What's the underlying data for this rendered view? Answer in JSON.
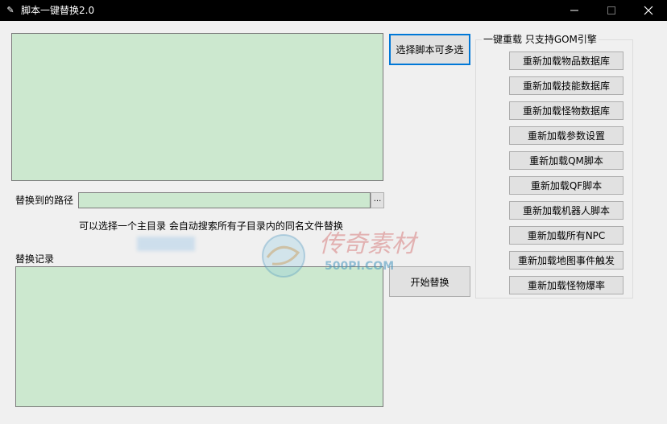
{
  "window": {
    "title": "脚本一键替换2.0",
    "controls": {
      "minimize": "—",
      "maximize": "☐",
      "close": "✕"
    }
  },
  "main": {
    "select_button": "选择脚本可多选",
    "path_label": "替换到的路径",
    "path_value": "",
    "browse_button": "...",
    "hint": "可以选择一个主目录 会自动搜索所有子目录内的同名文件替换",
    "log_label": "替换记录",
    "start_button": "开始替换"
  },
  "reload_group": {
    "title": "一键重载 只支持GOM引擎",
    "buttons": [
      "重新加载物品数据库",
      "重新加载技能数据库",
      "重新加载怪物数据库",
      "重新加载参数设置",
      "重新加载QM脚本",
      "重新加载QF脚本",
      "重新加载机器人脚本",
      "重新加载所有NPC",
      "重新加载地图事件触发",
      "重新加载怪物爆率"
    ]
  },
  "watermark": {
    "script": "传奇素材",
    "site": "500PI.COM"
  },
  "colors": {
    "textbox_bg": "#cce8cf",
    "titlebar_bg": "#000000",
    "focus_border": "#0078d7"
  }
}
